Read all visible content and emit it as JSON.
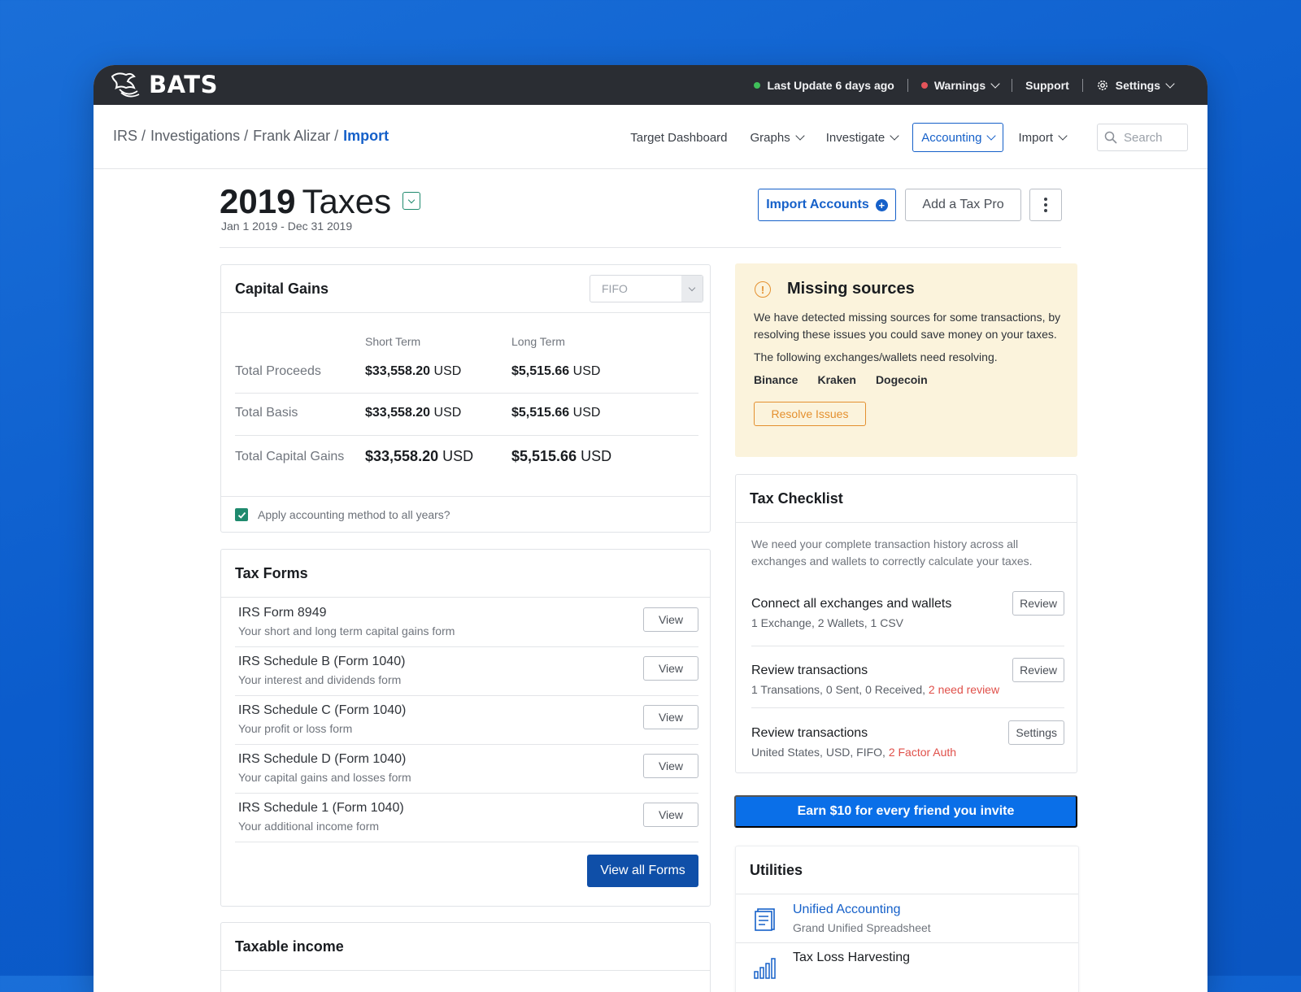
{
  "app": {
    "name": "BATS"
  },
  "topbar": {
    "last_update": "Last Update 6 days ago",
    "warnings": "Warnings",
    "support": "Support",
    "settings": "Settings",
    "status_ok_color": "#3fbf5a",
    "status_warn_color": "#e5545a"
  },
  "breadcrumb": [
    "IRS /",
    "Investigations /",
    "Frank Alizar /",
    "Import"
  ],
  "nav": {
    "target_dashboard": "Target Dashboard",
    "graphs": "Graphs",
    "investigate": "Investigate",
    "accounting": "Accounting",
    "import": "Import",
    "search_placeholder": "Search"
  },
  "page": {
    "year": "2019",
    "title": "Taxes",
    "date_range": "Jan 1 2019 - Dec 31 2019",
    "import_accounts": "Import Accounts",
    "add_tax_pro": "Add a Tax Pro"
  },
  "capital_gains": {
    "title": "Capital Gains",
    "method": "FIFO",
    "col_short": "Short Term",
    "col_long": "Long Term",
    "rows": [
      {
        "label": "Total Proceeds",
        "short": "$33,558.20",
        "long": "$5,515.66",
        "unit": "USD"
      },
      {
        "label": "Total Basis",
        "short": "$33,558.20",
        "long": "$5,515.66",
        "unit": "USD"
      },
      {
        "label": "Total Capital Gains",
        "short": "$33,558.20",
        "long": "$5,515.66",
        "unit": "USD"
      }
    ],
    "apply_all": "Apply accounting method to all years?"
  },
  "tax_forms": {
    "title": "Tax Forms",
    "view_label": "View",
    "items": [
      {
        "name": "IRS Form 8949",
        "suffix": "",
        "desc": "Your short and long term capital gains form"
      },
      {
        "name": "IRS Schedule B",
        "suffix": "(Form 1040)",
        "desc": "Your interest and dividends form"
      },
      {
        "name": "IRS Schedule C",
        "suffix": "(Form 1040)",
        "desc": "Your profit or loss form"
      },
      {
        "name": "IRS Schedule D",
        "suffix": "(Form 1040)",
        "desc": "Your capital gains and losses form"
      },
      {
        "name": "IRS Schedule 1",
        "suffix": "(Form 1040)",
        "desc": "Your additional income form"
      }
    ],
    "view_all": "View all Forms"
  },
  "taxable_income": {
    "title": "Taxable income"
  },
  "missing_sources": {
    "title": "Missing sources",
    "text": "We have detected missing sources for some transactions, by resolving these issues you could save money on your taxes.",
    "subtext": "The following exchanges/wallets need resolving.",
    "exchanges": [
      "Binance",
      "Kraken",
      "Dogecoin"
    ],
    "resolve": "Resolve Issues"
  },
  "tax_checklist": {
    "title": "Tax Checklist",
    "intro": "We need your complete transaction history across all exchanges and wallets to correctly calculate your taxes.",
    "items": [
      {
        "title": "Connect all exchanges and wallets",
        "sub": "1 Exchange, 2 Wallets, 1 CSV",
        "warn": "",
        "action": "Review"
      },
      {
        "title": "Review transactions",
        "sub": "1 Transations, 0 Sent, 0 Received,",
        "warn": "2 need review",
        "action": "Review"
      },
      {
        "title": "Review transactions",
        "sub": "United States, USD, FIFO,",
        "warn": "2 Factor Auth",
        "action": "Settings"
      }
    ]
  },
  "referral": "Earn $10 for every friend you invite",
  "utilities": {
    "title": "Utilities",
    "items": [
      {
        "title": "Unified Accounting",
        "sub": "Grand Unified Spreadsheet"
      },
      {
        "title": "Tax Loss Harvesting",
        "sub": ""
      }
    ]
  }
}
